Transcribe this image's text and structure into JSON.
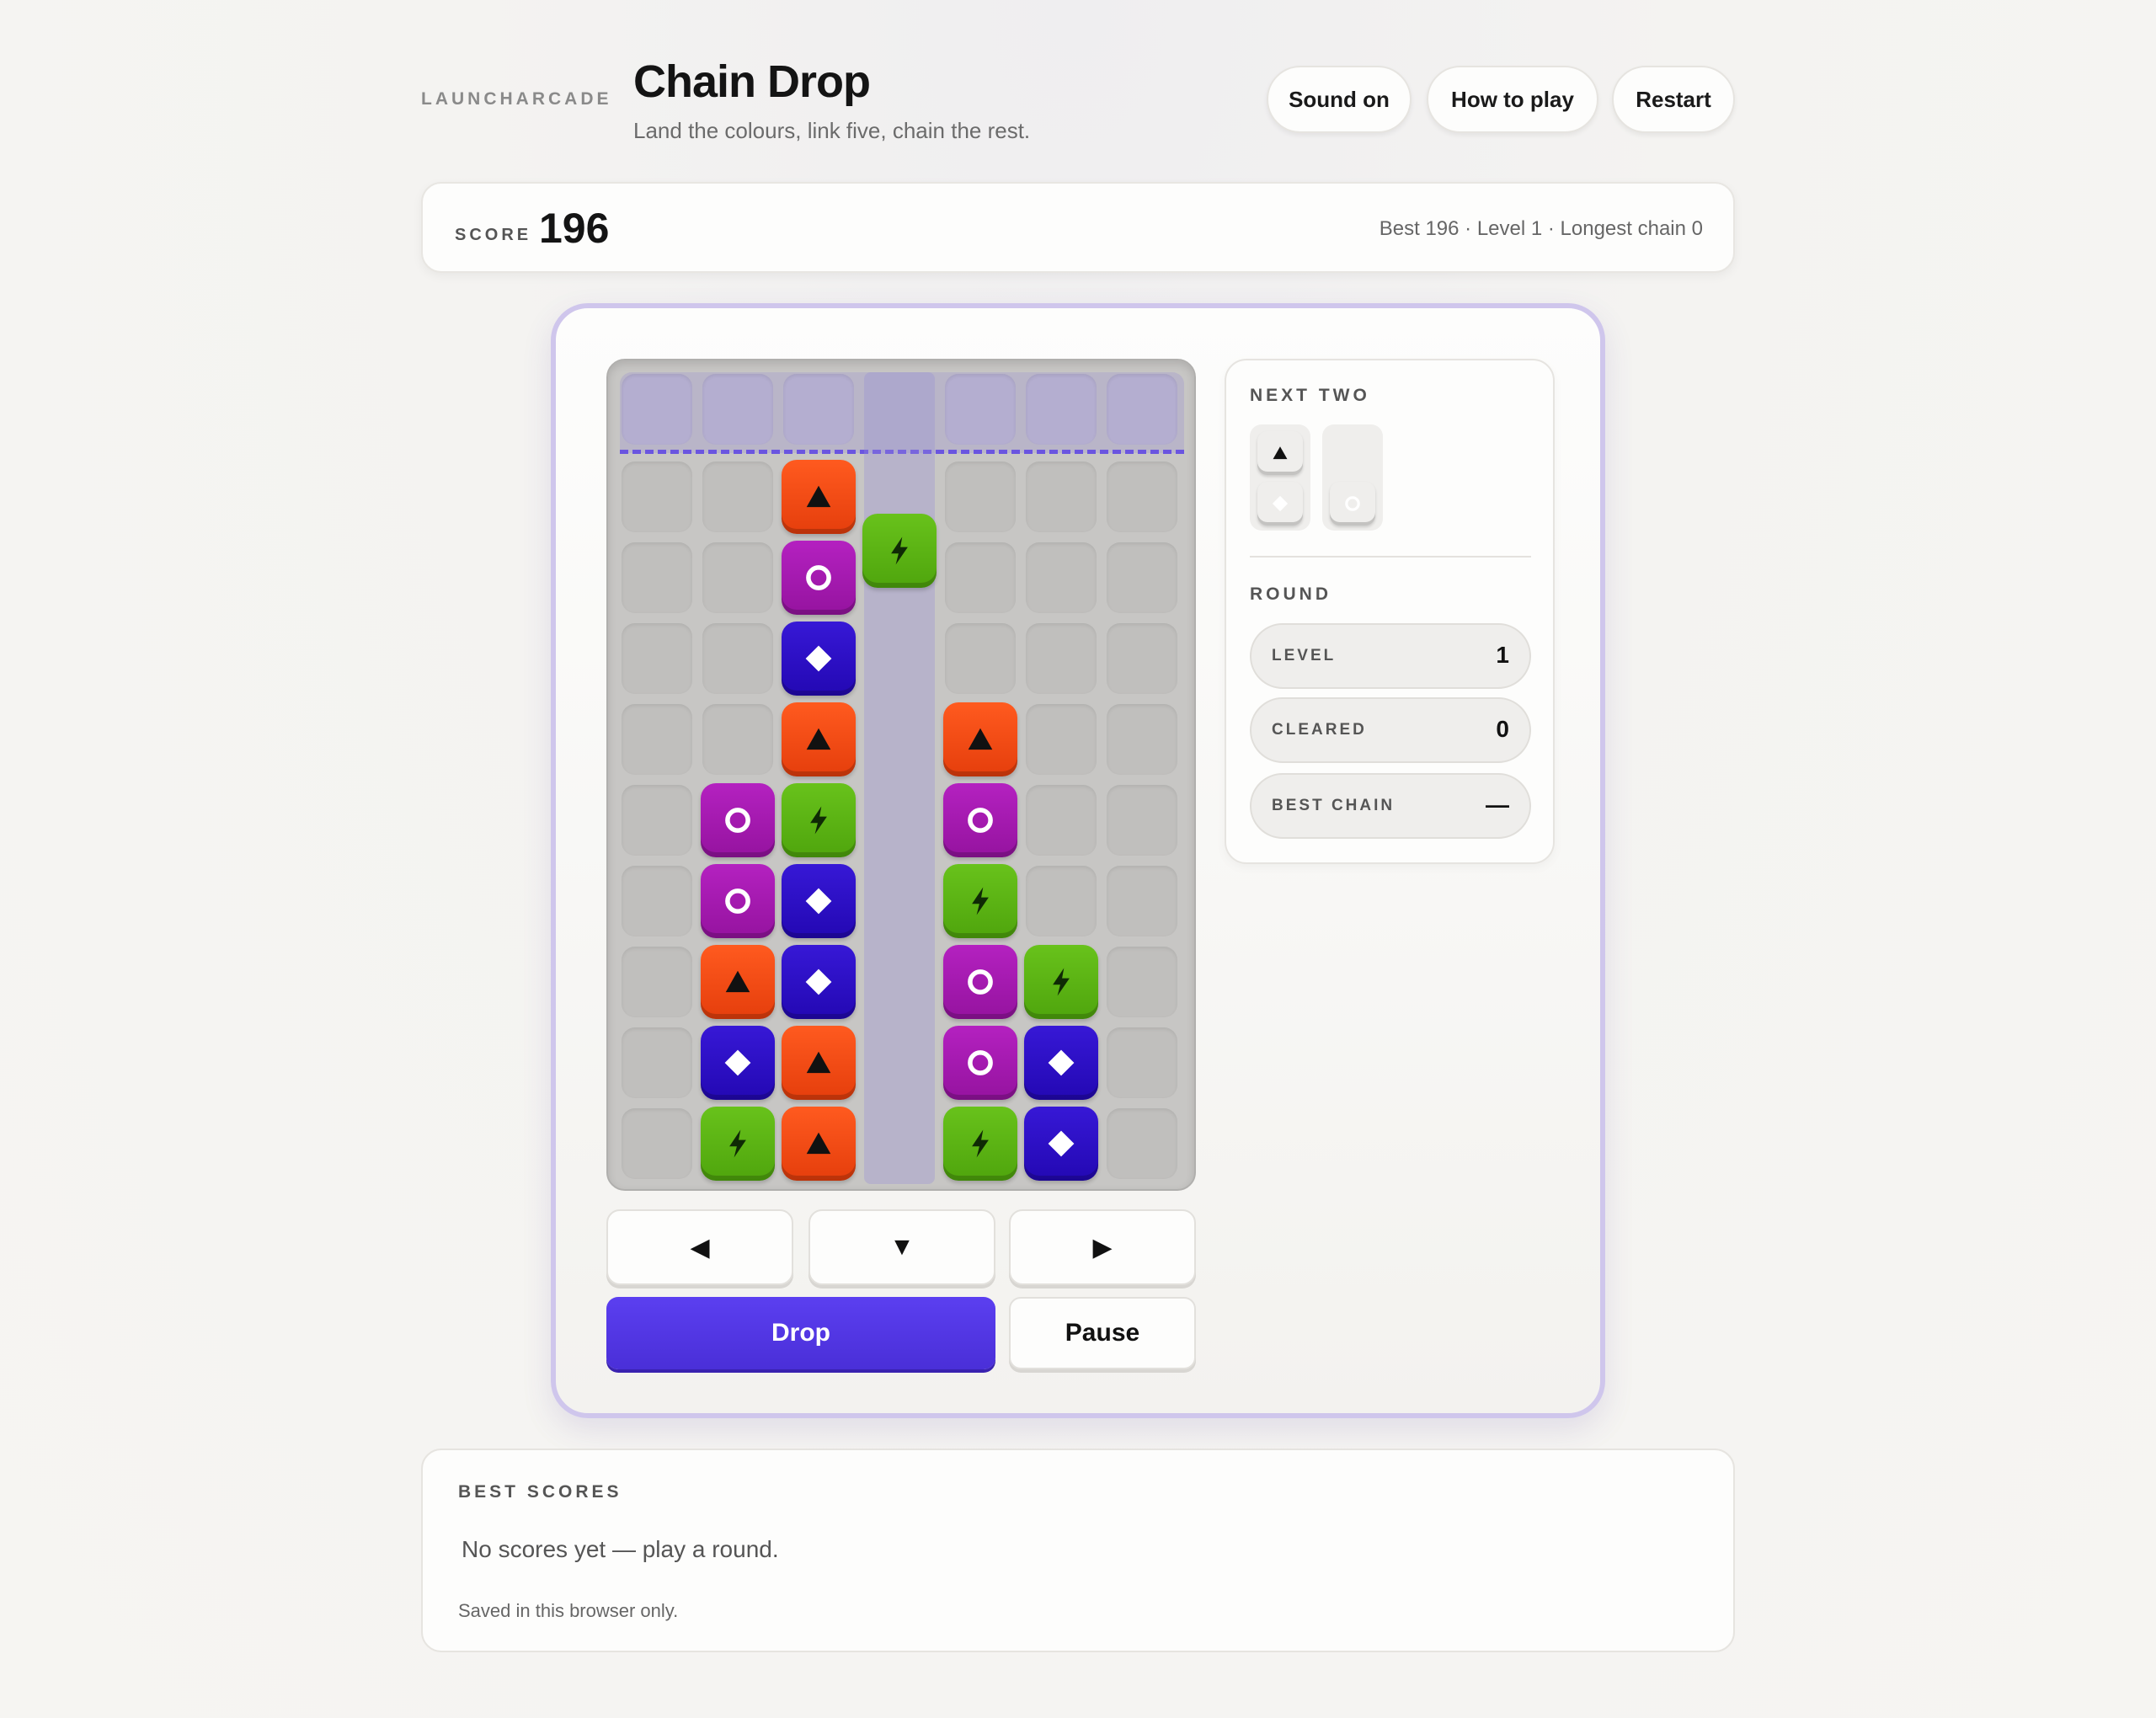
{
  "header": {
    "brand": "LAUNCHARCADE",
    "title": "Chain Drop",
    "subtitle": "Land the colours, link five, chain the rest.",
    "buttons": {
      "sound": "Sound on",
      "how_to_play": "How to play",
      "restart": "Restart"
    }
  },
  "score_bar": {
    "label": "SCORE",
    "value": "196",
    "meta": "Best 196 · Level 1 · Longest chain 0"
  },
  "board": {
    "columns": 7,
    "rows": 10,
    "active_column": 3,
    "falling_piece": {
      "column": 3,
      "color": "green",
      "symbol": "bolt"
    },
    "tiles": [
      {
        "col": 2,
        "row": 1,
        "color": "red",
        "symbol": "triangle"
      },
      {
        "col": 2,
        "row": 2,
        "color": "purple",
        "symbol": "ring"
      },
      {
        "col": 2,
        "row": 3,
        "color": "blue",
        "symbol": "diamond"
      },
      {
        "col": 2,
        "row": 4,
        "color": "red",
        "symbol": "triangle"
      },
      {
        "col": 2,
        "row": 5,
        "color": "green",
        "symbol": "bolt"
      },
      {
        "col": 2,
        "row": 6,
        "color": "blue",
        "symbol": "diamond"
      },
      {
        "col": 2,
        "row": 7,
        "color": "blue",
        "symbol": "diamond"
      },
      {
        "col": 2,
        "row": 8,
        "color": "red",
        "symbol": "triangle"
      },
      {
        "col": 2,
        "row": 9,
        "color": "red",
        "symbol": "triangle"
      },
      {
        "col": 1,
        "row": 5,
        "color": "purple",
        "symbol": "ring"
      },
      {
        "col": 1,
        "row": 6,
        "color": "purple",
        "symbol": "ring"
      },
      {
        "col": 1,
        "row": 7,
        "color": "red",
        "symbol": "triangle"
      },
      {
        "col": 1,
        "row": 8,
        "color": "blue",
        "symbol": "diamond"
      },
      {
        "col": 1,
        "row": 9,
        "color": "green",
        "symbol": "bolt"
      },
      {
        "col": 4,
        "row": 4,
        "color": "red",
        "symbol": "triangle"
      },
      {
        "col": 4,
        "row": 5,
        "color": "purple",
        "symbol": "ring"
      },
      {
        "col": 4,
        "row": 6,
        "color": "green",
        "symbol": "bolt"
      },
      {
        "col": 4,
        "row": 7,
        "color": "purple",
        "symbol": "ring"
      },
      {
        "col": 4,
        "row": 8,
        "color": "purple",
        "symbol": "ring"
      },
      {
        "col": 4,
        "row": 9,
        "color": "green",
        "symbol": "bolt"
      },
      {
        "col": 5,
        "row": 7,
        "color": "green",
        "symbol": "bolt"
      },
      {
        "col": 5,
        "row": 8,
        "color": "blue",
        "symbol": "diamond"
      },
      {
        "col": 5,
        "row": 9,
        "color": "blue",
        "symbol": "diamond"
      }
    ]
  },
  "controls": {
    "left": "◀",
    "down": "▼",
    "right": "▶",
    "drop": "Drop",
    "pause": "Pause"
  },
  "side_panel": {
    "next_heading": "NEXT TWO",
    "next": [
      [
        {
          "color": "red",
          "symbol": "triangle"
        },
        {
          "color": "blue",
          "symbol": "diamond"
        }
      ],
      [
        {
          "color": "purple",
          "symbol": "ring"
        }
      ]
    ],
    "round_heading": "ROUND",
    "stats": [
      {
        "label": "LEVEL",
        "value": "1"
      },
      {
        "label": "CLEARED",
        "value": "0"
      },
      {
        "label": "BEST CHAIN",
        "value": "—"
      }
    ]
  },
  "best_scores": {
    "heading": "BEST SCORES",
    "empty_text": "No scores yet — play a round.",
    "note": "Saved in this browser only."
  },
  "colors": {
    "red": "#f04a14",
    "purple": "#a51aaf",
    "blue": "#2c10c6",
    "green": "#5cb414",
    "accent": "#5236e6"
  }
}
